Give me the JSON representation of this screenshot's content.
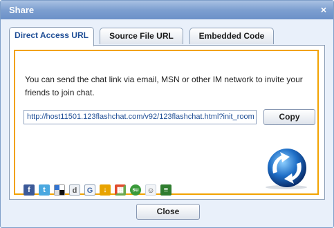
{
  "window": {
    "title": "Share",
    "close_symbol": "×"
  },
  "tabs": [
    {
      "label": "Direct Access URL",
      "active": true
    },
    {
      "label": "Source File URL",
      "active": false
    },
    {
      "label": "Embedded Code",
      "active": false
    }
  ],
  "panel": {
    "message": "You can send the chat link via email, MSN or other IM network to invite your friends to join chat.",
    "url_value": "http://host11501.123flashchat.com/v92/123flashchat.html?init_room",
    "copy_label": "Copy"
  },
  "share_icons": [
    {
      "name": "facebook-icon",
      "glyph": "f",
      "color": "#3b5998"
    },
    {
      "name": "twitter-icon",
      "glyph": "t",
      "color": "#4aa8e0"
    },
    {
      "name": "delicious-icon",
      "glyph": "",
      "color": "#1e1e1e"
    },
    {
      "name": "digg-icon",
      "glyph": "d",
      "color": "#9aa7b5"
    },
    {
      "name": "google-bookmarks-icon",
      "glyph": "G",
      "color": "#8ea0b6"
    },
    {
      "name": "download-icon",
      "glyph": "↓",
      "color": "#e8a300"
    },
    {
      "name": "windows-live-icon",
      "glyph": "▦",
      "color": "#6aa84f"
    },
    {
      "name": "stumbleupon-icon",
      "glyph": "su",
      "color": "#3a9a3a"
    },
    {
      "name": "reddit-icon",
      "glyph": "☺",
      "color": "#c8d2de"
    },
    {
      "name": "technorati-icon",
      "glyph": "≡",
      "color": "#2f7d2f"
    }
  ],
  "footer": {
    "close_label": "Close"
  },
  "colors": {
    "accent_border": "#f2a200",
    "title_bar": "#7d9fd0",
    "active_tab_text": "#1f4e96"
  }
}
